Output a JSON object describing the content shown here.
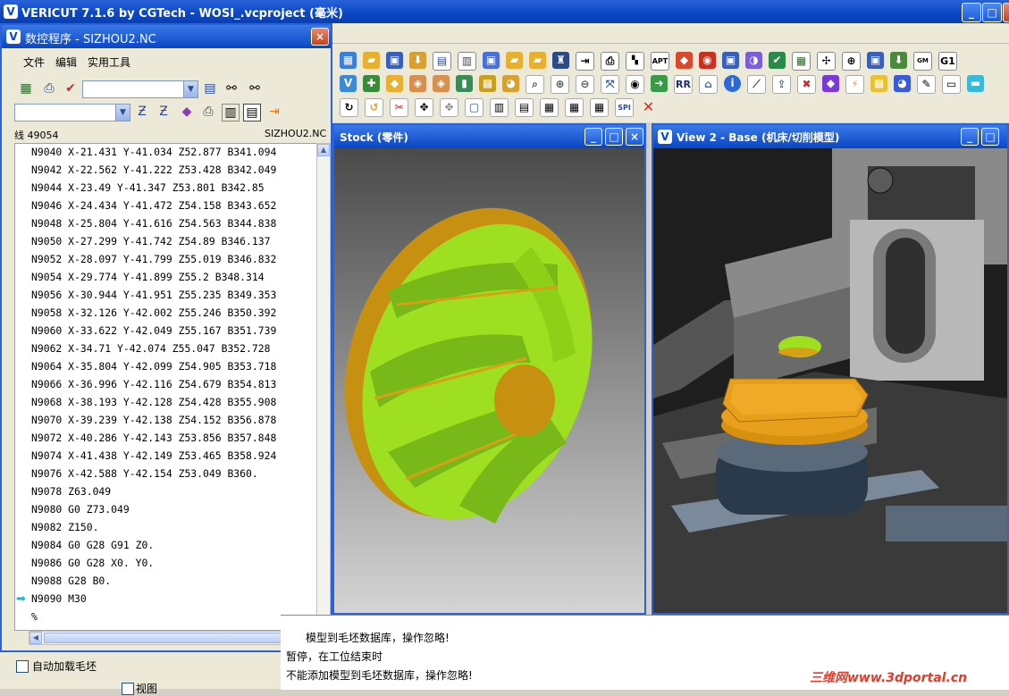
{
  "app": {
    "title": "VERICUT 7.1.6 by CGTech - WOSI_.vcproject (毫米)",
    "logo_text": "V"
  },
  "nc_window": {
    "title": "数控程序 - SIZHOU2.NC",
    "menu": [
      "文件",
      "编辑",
      "实用工具"
    ],
    "status_left": "线 49054",
    "status_right": "SIZHOU2.NC",
    "lines": [
      "N9040 X-21.431 Y-41.034 Z52.877 B341.094",
      "N9042 X-22.562 Y-41.222 Z53.428 B342.049",
      "N9044 X-23.49 Y-41.347 Z53.801 B342.85",
      "N9046 X-24.434 Y-41.472 Z54.158 B343.652",
      "N9048 X-25.804 Y-41.616 Z54.563 B344.838",
      "N9050 X-27.299 Y-41.742 Z54.89 B346.137",
      "N9052 X-28.097 Y-41.799 Z55.019 B346.832",
      "N9054 X-29.774 Y-41.899 Z55.2 B348.314",
      "N9056 X-30.944 Y-41.951 Z55.235 B349.353",
      "N9058 X-32.126 Y-42.002 Z55.246 B350.392",
      "N9060 X-33.622 Y-42.049 Z55.167 B351.739",
      "N9062 X-34.71 Y-42.074 Z55.047 B352.728",
      "N9064 X-35.804 Y-42.099 Z54.905 B353.718",
      "N9066 X-36.996 Y-42.116 Z54.679 B354.813",
      "N9068 X-38.193 Y-42.128 Z54.428 B355.908",
      "N9070 X-39.239 Y-42.138 Z54.152 B356.878",
      "N9072 X-40.286 Y-42.143 Z53.856 B357.848",
      "N9074 X-41.438 Y-42.149 Z53.465 B358.924",
      "N9076 X-42.588 Y-42.154 Z53.049 B360.",
      "N9078 Z63.049",
      "N9080 G0 Z73.049",
      "N9082 Z150.",
      "N9084 G0 G28 G91 Z0.",
      "N9086 G0 G28 X0. Y0.",
      "N9088 G28 B0.",
      "N9090 M30",
      "%"
    ],
    "current_line_index": 25
  },
  "views": {
    "stock_title": "Stock (零件)",
    "view2_title": "View 2 - Base (机床/切削模型)"
  },
  "log": {
    "lines": [
      "模型到毛坯数据库，操作忽略!",
      "暂停，在工位结束时",
      "不能添加模型到毛坯数据库，操作忽略!"
    ]
  },
  "bottom_left": {
    "checkbox_label": "自动加载毛坯",
    "partial_label": "视图"
  },
  "toolbar_text": {
    "apt": "APT",
    "rr": "RR",
    "g1": "G1",
    "gmxy": "GM XY",
    "spi": "SPI"
  },
  "watermark": "三维网www.3dportal.cn",
  "colors": {
    "titlebar": "#0a46c4",
    "part_green": "#9ee021",
    "part_gold": "#d8a014",
    "fixture_orange": "#e8a01c"
  }
}
